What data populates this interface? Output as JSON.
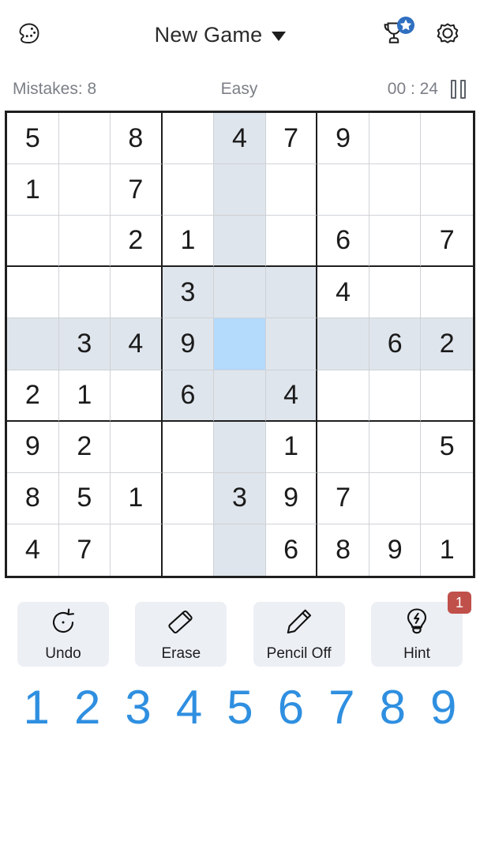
{
  "header": {
    "theme_icon": "palette-icon",
    "title": "New Game",
    "dropdown_icon": "chevron-down-icon",
    "trophy_icon": "trophy-icon",
    "trophy_badge_icon": "star-badge-icon",
    "settings_icon": "gear-icon"
  },
  "status": {
    "mistakes": "Mistakes: 8",
    "difficulty": "Easy",
    "timer": "00 : 24",
    "pause_icon": "pause-icon"
  },
  "board": {
    "selected": {
      "row": 5,
      "col": 5
    },
    "rows": [
      [
        "5",
        "",
        "8",
        "",
        "4",
        "7",
        "9",
        "",
        ""
      ],
      [
        "1",
        "",
        "7",
        "",
        "",
        "",
        "",
        "",
        ""
      ],
      [
        "",
        "",
        "2",
        "1",
        "",
        "",
        "6",
        "",
        "7"
      ],
      [
        "",
        "",
        "",
        "3",
        "",
        "",
        "4",
        "",
        ""
      ],
      [
        "",
        "3",
        "4",
        "9",
        "",
        "",
        "",
        "6",
        "2"
      ],
      [
        "2",
        "1",
        "",
        "6",
        "",
        "4",
        "",
        "",
        ""
      ],
      [
        "9",
        "2",
        "",
        "",
        "",
        "1",
        "",
        "",
        "5"
      ],
      [
        "8",
        "5",
        "1",
        "",
        "3",
        "9",
        "7",
        "",
        ""
      ],
      [
        "4",
        "7",
        "",
        "",
        "",
        "6",
        "8",
        "9",
        "1"
      ]
    ]
  },
  "actions": [
    {
      "label": "Undo",
      "icon": "undo-icon"
    },
    {
      "label": "Erase",
      "icon": "eraser-icon"
    },
    {
      "label": "Pencil Off",
      "icon": "pencil-icon"
    },
    {
      "label": "Hint",
      "icon": "lightbulb-icon",
      "badge": "1"
    }
  ],
  "numpad": [
    "1",
    "2",
    "3",
    "4",
    "5",
    "6",
    "7",
    "8",
    "9"
  ],
  "colors": {
    "accent": "#2f8fe0",
    "selected_cell": "#b4dafc",
    "highlight_cell": "#dfe5ec",
    "badge_red": "#c0504a",
    "grid_line": "#1e1e1e"
  }
}
